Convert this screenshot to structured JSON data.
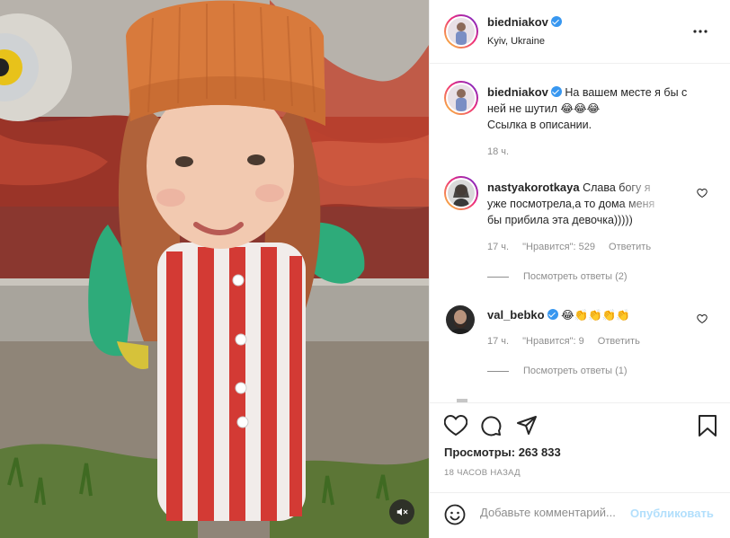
{
  "post": {
    "author": {
      "username": "biedniakov",
      "verified": true,
      "location": "Kyiv, Ukraine",
      "avatar": "avatar-icon"
    },
    "caption": {
      "username": "biedniakov",
      "line1": "На вашем месте я бы с",
      "line2": "ней не шутил 😂😂😂",
      "line3": "Ссылка в описании.",
      "time": "18 ч."
    },
    "comments": [
      {
        "username": "nastyakorotkaya",
        "text_line1": "Слава богу я",
        "text_line2": "уже посмотрела,а то дома меня",
        "text_line3": "бы прибила эта девочка)))))",
        "time": "17 ч.",
        "likes": "\"Нравится\": 529",
        "reply_label": "Ответить",
        "view_replies": "Посмотреть ответы (2)"
      },
      {
        "username": "val_bebko",
        "verified": true,
        "text_line1": "😂👏👏👏👏",
        "time": "17 ч.",
        "likes": "\"Нравится\": 9",
        "reply_label": "Ответить",
        "view_replies": "Посмотреть ответы (1)"
      }
    ],
    "views_label": "Просмотры: 263 833",
    "timestamp": "18 ЧАСОВ НАЗАД",
    "comment_box": {
      "placeholder": "Добавьте комментарий...",
      "post_label": "Опубликовать"
    },
    "icons": [
      "heart-icon",
      "comment-icon",
      "share-icon",
      "bookmark-icon",
      "more-icon",
      "emoji-icon",
      "mute-icon"
    ],
    "colors": {
      "link_blue": "#3897f0",
      "post_disabled": "#b2dffc",
      "muted_text": "#8e8e8e",
      "border": "#efefef"
    }
  }
}
